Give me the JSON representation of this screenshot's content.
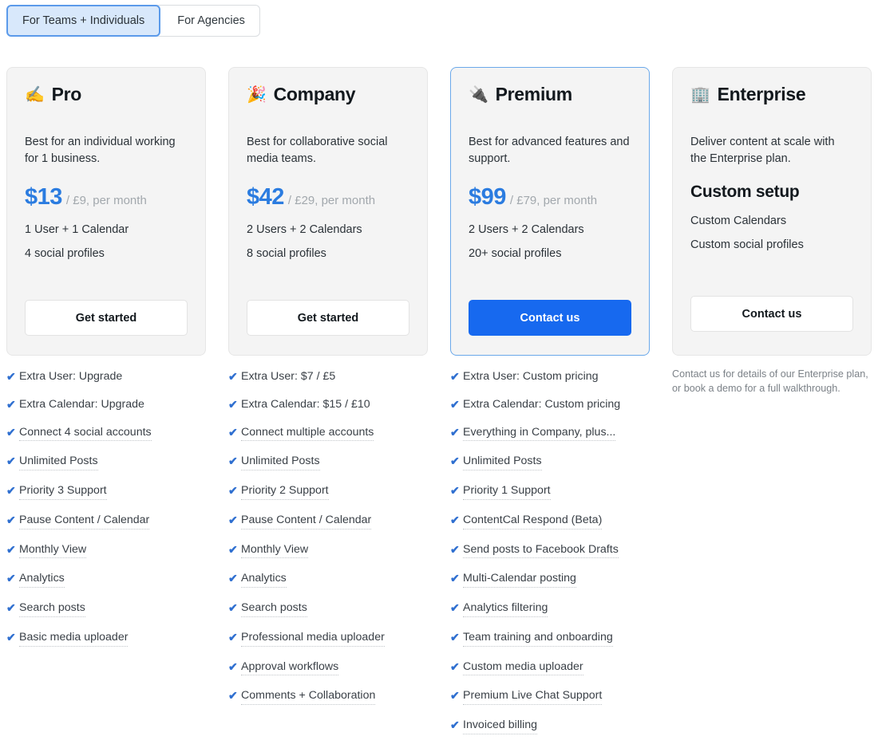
{
  "tabs": [
    {
      "label": "For Teams + Individuals",
      "active": true
    },
    {
      "label": "For Agencies",
      "active": false
    }
  ],
  "plans": [
    {
      "emoji": "✍️",
      "emoji_name": "writing-hand-emoji",
      "name": "Pro",
      "description": "Best for an individual working for 1 business.",
      "price_main": "$13",
      "price_sub": "/ £9, per month",
      "line1": "1 User + 1 Calendar",
      "line2": "4 social profiles",
      "cta": "Get started",
      "cta_style": "light",
      "featured": false,
      "features": [
        {
          "label": "Extra User: Upgrade",
          "dotted": false
        },
        {
          "label": "Extra Calendar: Upgrade",
          "dotted": false
        },
        {
          "label": "Connect 4 social accounts",
          "dotted": true
        },
        {
          "label": "Unlimited Posts",
          "dotted": true
        },
        {
          "label": "Priority 3 Support",
          "dotted": true
        },
        {
          "label": "Pause Content / Calendar",
          "dotted": true
        },
        {
          "label": "Monthly View",
          "dotted": true
        },
        {
          "label": "Analytics",
          "dotted": true
        },
        {
          "label": "Search posts",
          "dotted": true
        },
        {
          "label": "Basic media uploader",
          "dotted": true
        }
      ]
    },
    {
      "emoji": "🎉",
      "emoji_name": "party-popper-emoji",
      "name": "Company",
      "description": "Best for collaborative social media teams.",
      "price_main": "$42",
      "price_sub": "/ £29, per month",
      "line1": "2 Users + 2 Calendars",
      "line2": "8 social profiles",
      "cta": "Get started",
      "cta_style": "light",
      "featured": false,
      "features": [
        {
          "label": "Extra User: $7 / £5",
          "dotted": false
        },
        {
          "label": "Extra Calendar: $15 / £10",
          "dotted": false
        },
        {
          "label": "Connect multiple accounts",
          "dotted": true
        },
        {
          "label": "Unlimited Posts",
          "dotted": true
        },
        {
          "label": "Priority 2 Support",
          "dotted": true
        },
        {
          "label": "Pause Content / Calendar",
          "dotted": true
        },
        {
          "label": "Monthly View",
          "dotted": true
        },
        {
          "label": "Analytics",
          "dotted": true
        },
        {
          "label": "Search posts",
          "dotted": true
        },
        {
          "label": "Professional media uploader",
          "dotted": true
        },
        {
          "label": "Approval workflows",
          "dotted": true
        },
        {
          "label": "Comments + Collaboration",
          "dotted": true
        }
      ]
    },
    {
      "emoji": "🔌",
      "emoji_name": "electric-plug-emoji",
      "name": "Premium",
      "description": "Best for advanced features and support.",
      "price_main": "$99",
      "price_sub": "/ £79, per month",
      "line1": "2 Users + 2 Calendars",
      "line2": "20+ social profiles",
      "cta": "Contact us",
      "cta_style": "primary",
      "featured": true,
      "features": [
        {
          "label": "Extra User: Custom pricing",
          "dotted": false
        },
        {
          "label": "Extra Calendar: Custom pricing",
          "dotted": false
        },
        {
          "label": "Everything in Company, plus...",
          "dotted": true
        },
        {
          "label": "Unlimited Posts",
          "dotted": true
        },
        {
          "label": "Priority 1 Support",
          "dotted": true
        },
        {
          "label": "ContentCal Respond (Beta)",
          "dotted": true
        },
        {
          "label": "Send posts to Facebook Drafts",
          "dotted": true
        },
        {
          "label": "Multi-Calendar posting",
          "dotted": true
        },
        {
          "label": "Analytics filtering",
          "dotted": true
        },
        {
          "label": "Team training and onboarding",
          "dotted": true
        },
        {
          "label": "Custom media uploader",
          "dotted": true
        },
        {
          "label": "Premium Live Chat Support",
          "dotted": true
        },
        {
          "label": "Invoiced billing",
          "dotted": true
        }
      ]
    },
    {
      "emoji": "🏢",
      "emoji_name": "office-building-emoji",
      "name": "Enterprise",
      "description": "Deliver content at scale with the Enterprise plan.",
      "custom_setup": "Custom setup",
      "line1": "Custom Calendars",
      "line2": "Custom social profiles",
      "cta": "Contact us",
      "cta_style": "light",
      "featured": false,
      "note": "Contact us for details of our Enterprise plan, or book a demo for a full walkthrough.",
      "features": []
    }
  ],
  "icons": {
    "check": "✔"
  },
  "colors": {
    "price_blue": "#2b7ce0",
    "primary_button": "#1769ef",
    "check_blue": "#2f6fd0",
    "featured_border": "#6aa8ea",
    "card_bg": "#f4f4f4",
    "active_tab_bg": "#d8e8fb",
    "active_tab_border": "#5b9aea"
  }
}
